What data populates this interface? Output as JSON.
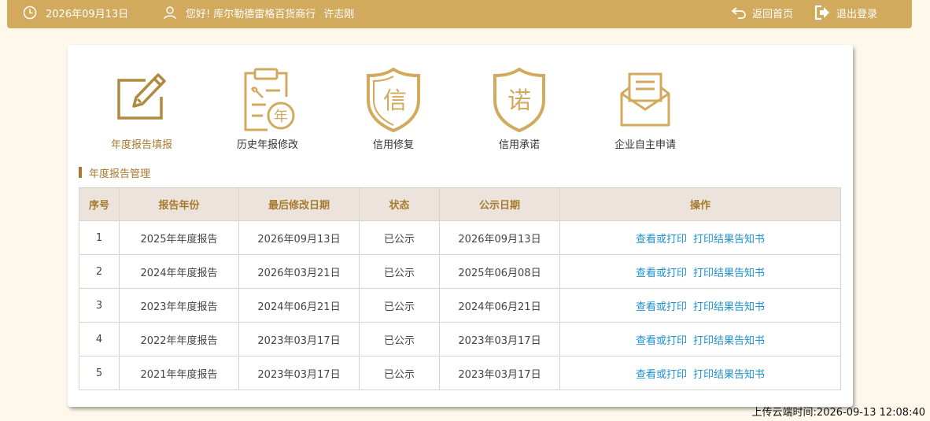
{
  "header": {
    "date": "2026年09月13日",
    "greeting": "您好!",
    "company": "库尔勒德雷格百货商行",
    "user": "许志刚",
    "home_label": "返回首页",
    "logout_label": "退出登录",
    "bg_color": "#d2aa5e"
  },
  "menu": [
    {
      "label": "年度报告填报",
      "icon": "edit-form-icon",
      "active": true
    },
    {
      "label": "历史年报修改",
      "icon": "clipboard-year-icon",
      "active": false
    },
    {
      "label": "信用修复",
      "icon": "shield-xin-icon",
      "active": false
    },
    {
      "label": "信用承诺",
      "icon": "shield-nuo-icon",
      "active": false
    },
    {
      "label": "企业自主申请",
      "icon": "envelope-icon",
      "active": false
    }
  ],
  "icon_glyphs": {
    "year": "年",
    "xin": "信",
    "nuo": "诺"
  },
  "section_title": "年度报告管理",
  "table": {
    "headers": [
      "序号",
      "报告年份",
      "最后修改日期",
      "状态",
      "公示日期",
      "操作"
    ],
    "rows": [
      {
        "no": "1",
        "year": "2025年年度报告",
        "modified": "2026年09月13日",
        "status": "已公示",
        "published": "2026年09月13日"
      },
      {
        "no": "2",
        "year": "2024年年度报告",
        "modified": "2026年03月21日",
        "status": "已公示",
        "published": "2025年06月08日"
      },
      {
        "no": "3",
        "year": "2023年年度报告",
        "modified": "2024年06月21日",
        "status": "已公示",
        "published": "2024年06月21日"
      },
      {
        "no": "4",
        "year": "2022年年度报告",
        "modified": "2023年03月17日",
        "status": "已公示",
        "published": "2023年03月17日"
      },
      {
        "no": "5",
        "year": "2021年年度报告",
        "modified": "2023年03月17日",
        "status": "已公示",
        "published": "2023年03月17日"
      }
    ],
    "action_view": "查看或打印",
    "action_print": "打印结果告知书"
  },
  "upload_time": "上传云端时间:2026-09-13 12:08:40",
  "colors": {
    "accent": "#a67b2e",
    "icon": "#d2aa5e",
    "link": "#1e8fcf"
  }
}
